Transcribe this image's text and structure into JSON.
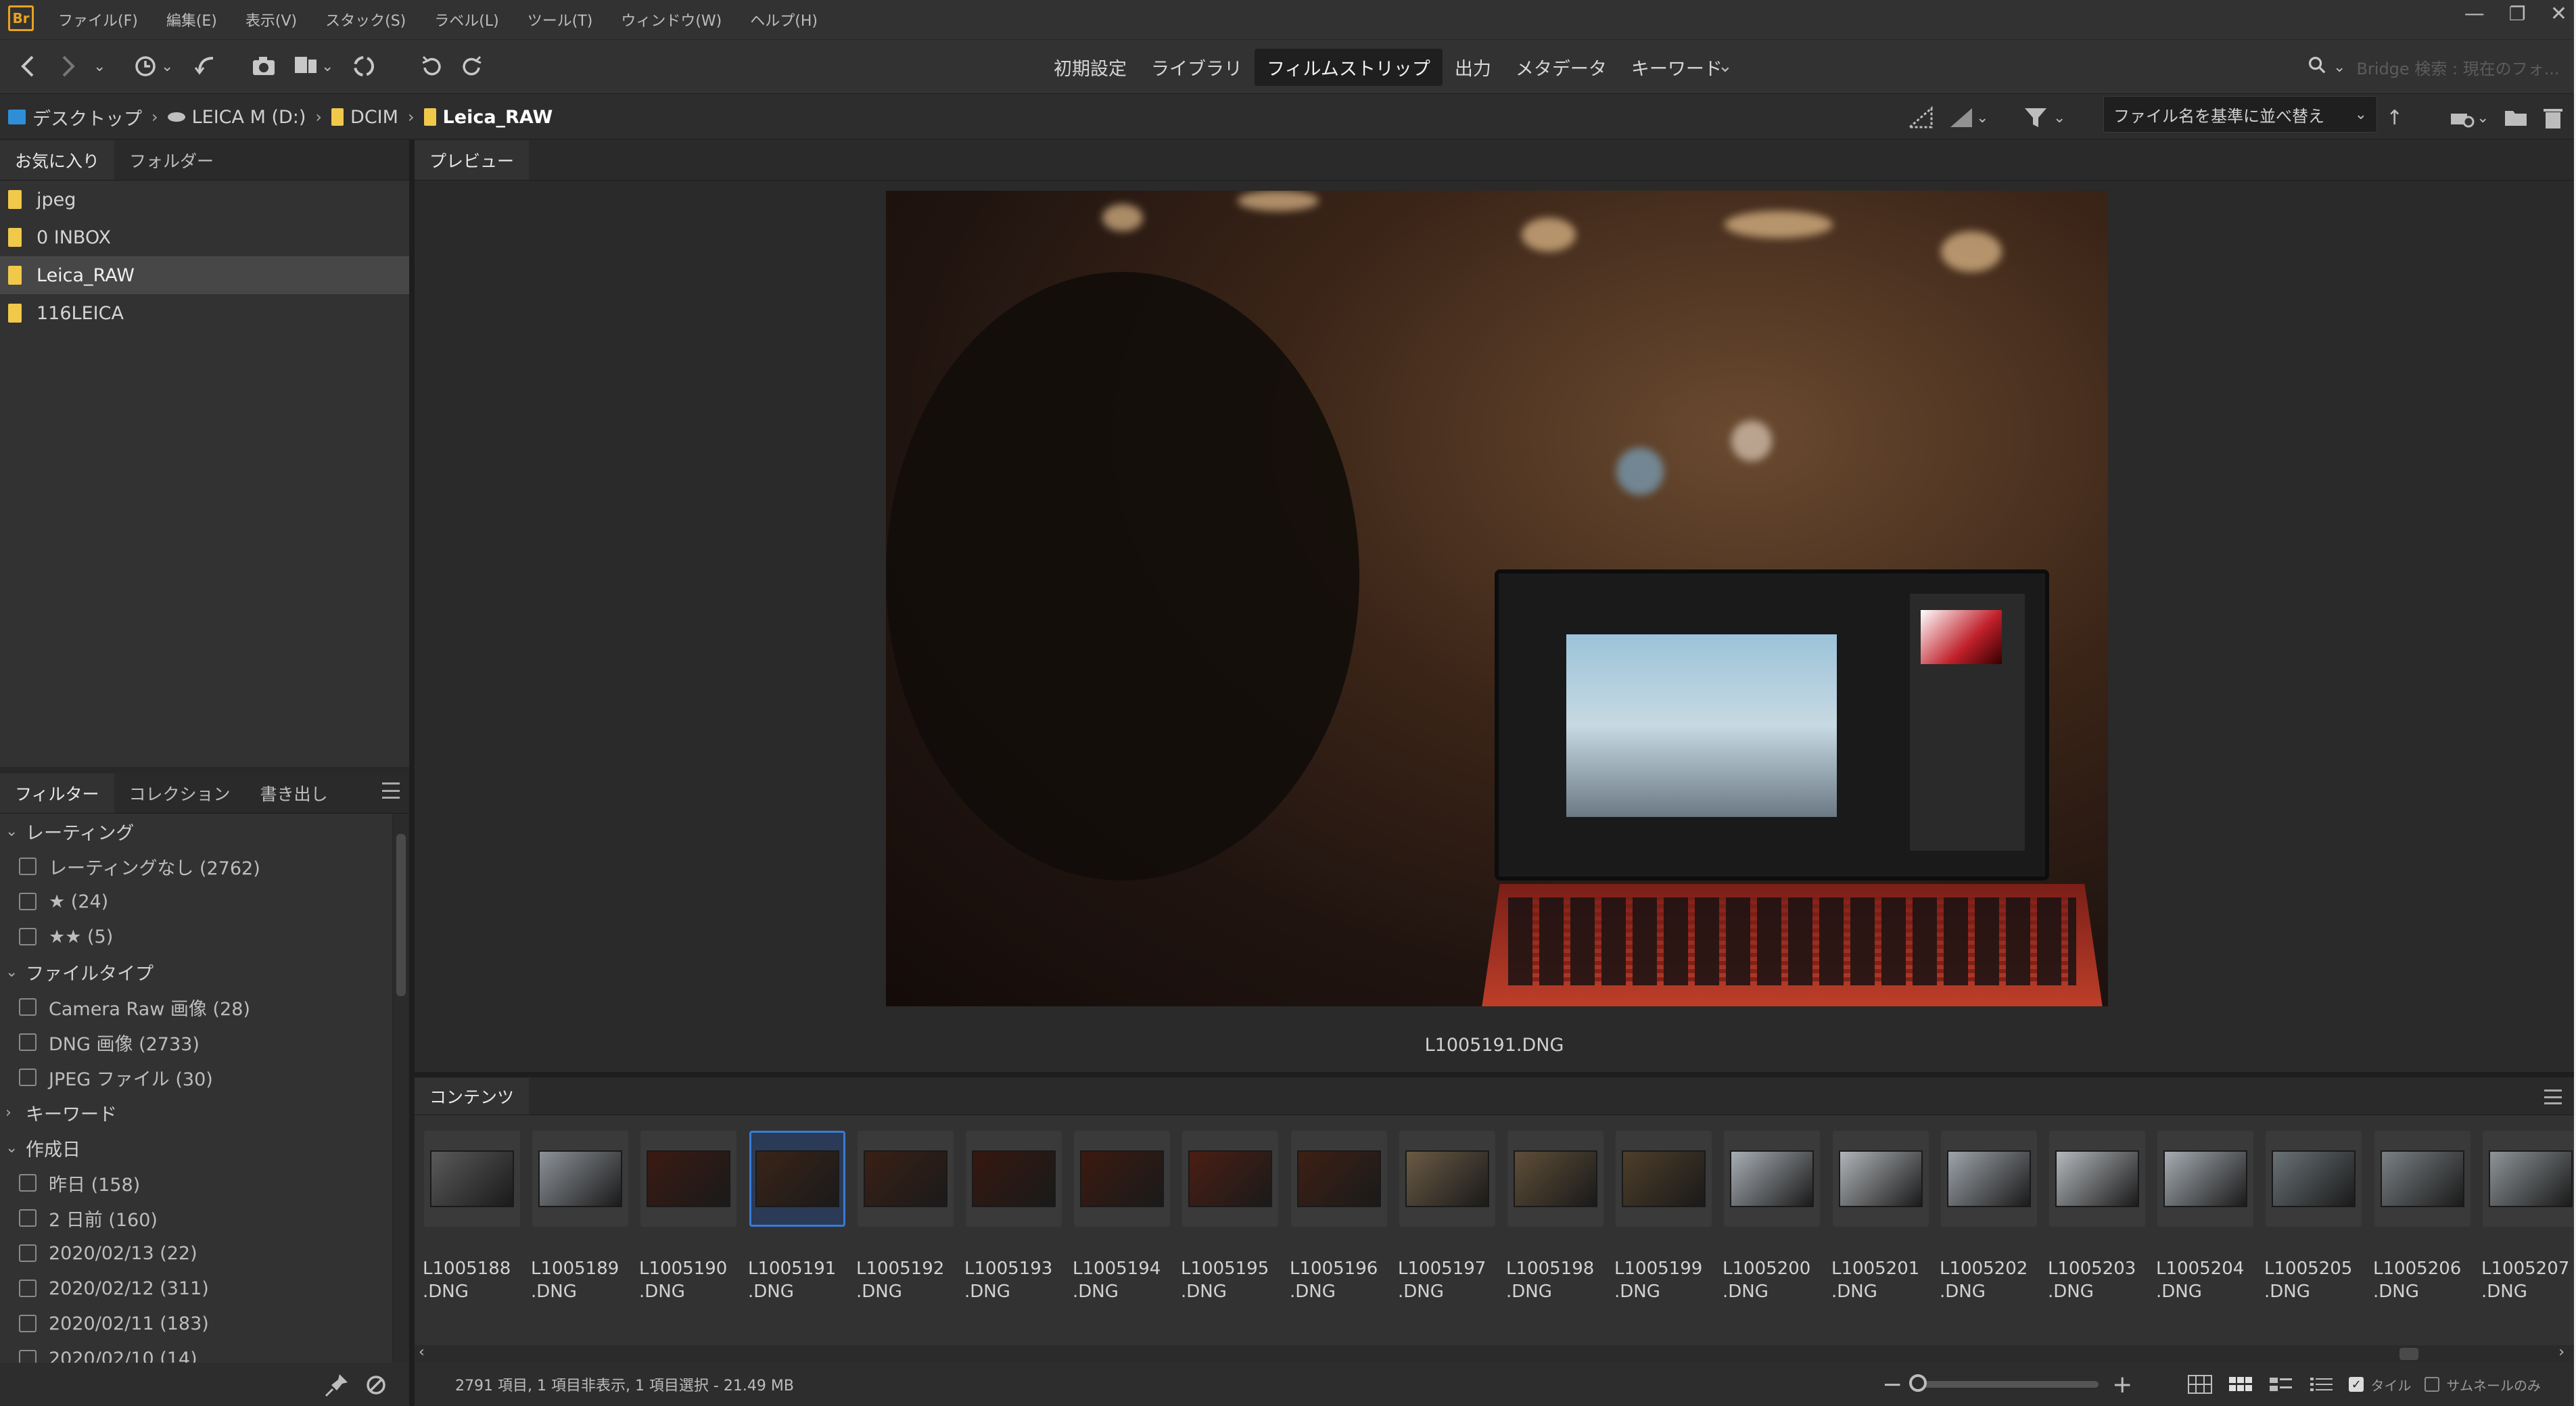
{
  "menubar": {
    "logo": "Br",
    "items": [
      "ファイル(F)",
      "編集(E)",
      "表示(V)",
      "スタック(S)",
      "ラベル(L)",
      "ツール(T)",
      "ウィンドウ(W)",
      "ヘルプ(H)"
    ],
    "window_buttons": [
      "—",
      "❐",
      "✕"
    ]
  },
  "toolbar": {
    "workspaces": [
      "初期設定",
      "ライブラリ",
      "フィルムストリップ",
      "出力",
      "メタデータ",
      "キーワード"
    ],
    "active_workspace": "フィルムストリップ",
    "search_placeholder": "Bridge 検索 : 現在のフォ..."
  },
  "pathbar": {
    "crumbs": [
      "デスクトップ",
      "LEICA M (D:)",
      "DCIM",
      "Leica_RAW"
    ],
    "sort_label": "ファイル名を基準に並べ替え"
  },
  "favorites": {
    "tabs": [
      "お気に入り",
      "フォルダー"
    ],
    "items": [
      "jpeg",
      "0 INBOX",
      "Leica_RAW",
      "116LEICA"
    ],
    "selected_index": 2
  },
  "filter": {
    "tabs": [
      "フィルター",
      "コレクション",
      "書き出し"
    ],
    "sections": [
      {
        "title": "レーティング",
        "open": true,
        "items": [
          "レーティングなし (2762)",
          "★ (24)",
          "★★ (5)"
        ]
      },
      {
        "title": "ファイルタイプ",
        "open": true,
        "items": [
          "Camera Raw 画像 (28)",
          "DNG 画像 (2733)",
          "JPEG ファイル (30)"
        ]
      },
      {
        "title": "キーワード",
        "open": false,
        "items": []
      },
      {
        "title": "作成日",
        "open": true,
        "items": [
          "昨日 (158)",
          "2 日前 (160)",
          "2020/02/13 (22)",
          "2020/02/12 (311)",
          "2020/02/11 (183)",
          "2020/02/10 (14)"
        ]
      }
    ]
  },
  "preview": {
    "tab": "プレビュー",
    "filename": "L1005191.DNG"
  },
  "content": {
    "tab": "コンテンツ",
    "selected_index": 3,
    "thumbnails": [
      {
        "name1": "L1005188",
        "name2": ".DNG",
        "tone": "#5a5a5a"
      },
      {
        "name1": "L1005189",
        "name2": ".DNG",
        "tone": "#8d9298"
      },
      {
        "name1": "L1005190",
        "name2": ".DNG",
        "tone": "#3a1a12"
      },
      {
        "name1": "L1005191",
        "name2": ".DNG",
        "tone": "#3a2418"
      },
      {
        "name1": "L1005192",
        "name2": ".DNG",
        "tone": "#3a2016"
      },
      {
        "name1": "L1005193",
        "name2": ".DNG",
        "tone": "#35180f"
      },
      {
        "name1": "L1005194",
        "name2": ".DNG",
        "tone": "#3b1a10"
      },
      {
        "name1": "L1005195",
        "name2": ".DNG",
        "tone": "#4a1e14"
      },
      {
        "name1": "L1005196",
        "name2": ".DNG",
        "tone": "#3d2014"
      },
      {
        "name1": "L1005197",
        "name2": ".DNG",
        "tone": "#6a5a44"
      },
      {
        "name1": "L1005198",
        "name2": ".DNG",
        "tone": "#5e4e38"
      },
      {
        "name1": "L1005199",
        "name2": ".DNG",
        "tone": "#4e3e2a"
      },
      {
        "name1": "L1005200",
        "name2": ".DNG",
        "tone": "#a8aeb4"
      },
      {
        "name1": "L1005201",
        "name2": ".DNG",
        "tone": "#b0b4b8"
      },
      {
        "name1": "L1005202",
        "name2": ".DNG",
        "tone": "#9ea4aa"
      },
      {
        "name1": "L1005203",
        "name2": ".DNG",
        "tone": "#b4b8bc"
      },
      {
        "name1": "L1005204",
        "name2": ".DNG",
        "tone": "#a6acb2"
      },
      {
        "name1": "L1005205",
        "name2": ".DNG",
        "tone": "#6a7276"
      },
      {
        "name1": "L1005206",
        "name2": ".DNG",
        "tone": "#7a8084"
      },
      {
        "name1": "L1005207",
        "name2": ".DNG",
        "tone": "#8e9498"
      }
    ]
  },
  "status": {
    "text": "2791 項目, 1 項目非表示, 1 項目選択 - 21.49 MB",
    "tile_label": "タイル",
    "thumb_only_label": "サムネールのみ",
    "zoom_fraction": 0.0
  },
  "colors": {
    "accent": "#3a7bd5",
    "folder": "#f0c84a",
    "logo": "#e8a21f"
  }
}
